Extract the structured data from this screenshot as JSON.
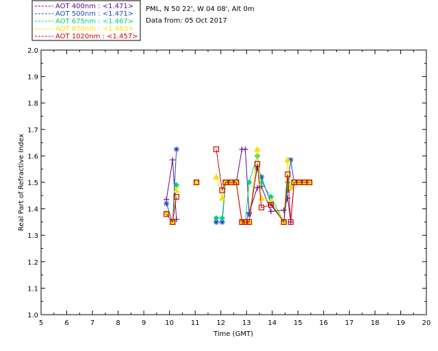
{
  "info": {
    "site_line": "PML, N 50 22', W 04 08', Alt 0m",
    "date_line": "Data from: 05 Oct 2017"
  },
  "chart_data": {
    "type": "scatter",
    "title": "",
    "xlabel": "Time (GMT)",
    "ylabel": "Real Part of Refractive Index",
    "xlim": [
      5,
      20
    ],
    "ylim": [
      1.0,
      2.0
    ],
    "x_ticks": [
      "5",
      "6",
      "7",
      "8",
      "9",
      "10",
      "11",
      "12",
      "13",
      "14",
      "15",
      "16",
      "17",
      "18",
      "19",
      "20"
    ],
    "y_ticks": [
      "1.0",
      "1.1",
      "1.2",
      "1.3",
      "1.4",
      "1.5",
      "1.6",
      "1.7",
      "1.8",
      "1.9",
      "2.0"
    ],
    "grid": false,
    "legend_position": "top-left",
    "series": [
      {
        "name": "AOT  400nm : <1.471>",
        "color": "#5a0a8a",
        "marker": "plus",
        "x": [
          9.88,
          10.12,
          10.27,
          11.05,
          11.82,
          12.05,
          12.18,
          12.4,
          12.6,
          12.82,
          12.95,
          13.1,
          13.42,
          13.58,
          13.95,
          14.45,
          14.6,
          14.72,
          14.85,
          15.05,
          15.25,
          15.45
        ],
        "y": [
          1.435,
          1.585,
          1.36,
          1.5,
          1.35,
          1.35,
          1.5,
          1.5,
          1.5,
          1.625,
          1.625,
          1.385,
          1.48,
          1.485,
          1.39,
          1.395,
          1.44,
          1.35,
          1.5,
          1.5,
          1.5,
          1.5
        ]
      },
      {
        "name": "AOT  500nm : <1.471>",
        "color": "#1f49c7",
        "marker": "star",
        "x": [
          9.88,
          10.12,
          10.27,
          11.05,
          11.82,
          12.05,
          12.18,
          12.4,
          12.6,
          12.82,
          12.95,
          13.1,
          13.42,
          13.58,
          13.95,
          14.45,
          14.6,
          14.72,
          14.85,
          15.05,
          15.25,
          15.45
        ],
        "y": [
          1.42,
          1.35,
          1.625,
          1.5,
          1.35,
          1.35,
          1.5,
          1.5,
          1.5,
          1.35,
          1.35,
          1.38,
          1.555,
          1.52,
          1.42,
          1.35,
          1.47,
          1.585,
          1.5,
          1.5,
          1.5,
          1.5
        ]
      },
      {
        "name": "AOT  675nm : <1.467>",
        "color": "#00d27a",
        "marker": "diamond",
        "x": [
          9.88,
          10.12,
          10.27,
          11.05,
          11.82,
          12.05,
          12.18,
          12.4,
          12.6,
          12.82,
          12.95,
          13.1,
          13.42,
          13.58,
          13.95,
          14.45,
          14.6,
          14.72,
          14.85,
          15.05,
          15.25,
          15.45
        ],
        "y": [
          1.385,
          1.35,
          1.49,
          1.5,
          1.365,
          1.365,
          1.5,
          1.5,
          1.5,
          1.35,
          1.35,
          1.5,
          1.6,
          1.5,
          1.445,
          1.35,
          1.5,
          1.48,
          1.5,
          1.5,
          1.5,
          1.5
        ]
      },
      {
        "name": "AOT  870nm : <1.463>",
        "color": "#f4e200",
        "marker": "triangle",
        "x": [
          9.88,
          10.12,
          10.27,
          11.05,
          11.82,
          12.05,
          12.18,
          12.4,
          12.6,
          12.82,
          12.95,
          13.1,
          13.42,
          13.58,
          13.95,
          14.45,
          14.6,
          14.72,
          14.85,
          15.05,
          15.25,
          15.45
        ],
        "y": [
          1.385,
          1.35,
          1.47,
          1.5,
          1.52,
          1.44,
          1.5,
          1.5,
          1.5,
          1.35,
          1.35,
          1.35,
          1.625,
          1.44,
          1.43,
          1.35,
          1.585,
          1.48,
          1.5,
          1.5,
          1.5,
          1.5
        ]
      },
      {
        "name": "AOT 1020nm : <1.457>",
        "color": "#d10000",
        "marker": "square",
        "x": [
          9.88,
          10.12,
          10.27,
          11.05,
          11.82,
          12.05,
          12.18,
          12.4,
          12.6,
          12.82,
          12.95,
          13.1,
          13.42,
          13.58,
          13.95,
          14.45,
          14.6,
          14.72,
          14.85,
          15.05,
          15.25,
          15.45
        ],
        "y": [
          1.38,
          1.35,
          1.445,
          1.5,
          1.625,
          1.47,
          1.5,
          1.5,
          1.5,
          1.35,
          1.35,
          1.35,
          1.57,
          1.405,
          1.415,
          1.35,
          1.53,
          1.35,
          1.5,
          1.5,
          1.5,
          1.5
        ]
      }
    ]
  }
}
